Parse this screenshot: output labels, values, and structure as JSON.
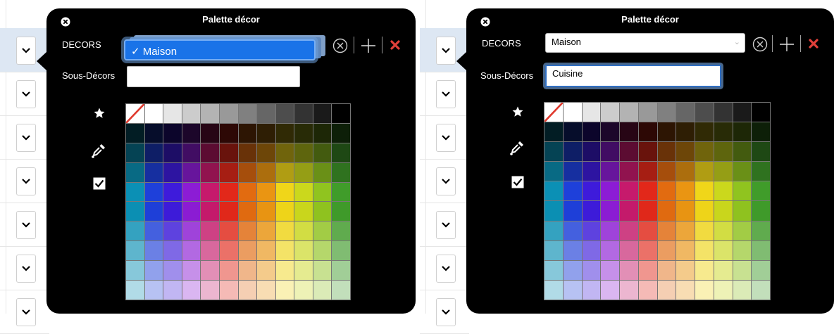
{
  "panels": [
    {
      "title": "Palette décor",
      "decors_label": "DECORS",
      "decors_value": "Maison",
      "decors_state": "open",
      "sous_decors_label": "Sous-Décors",
      "sous_decors_value": ""
    },
    {
      "title": "Palette décor",
      "decors_label": "DECORS",
      "decors_value": "Maison",
      "decors_state": "closed",
      "sous_decors_label": "Sous-Décors",
      "sous_decors_value": "Cuisine"
    }
  ],
  "icons": {
    "close": "circle-x-icon",
    "clear": "circle-x-outline-icon",
    "add": "plus-icon",
    "delete": "red-x-icon",
    "favorites": "star-icon",
    "eyedropper": "eyedropper-icon",
    "checkbox": "checkbox-icon",
    "row_dropdown": "chevron-down-icon"
  },
  "colors": {
    "panel_bg": "#000000",
    "delete_red": "#e0403a",
    "selection_blue": "#1a73e8"
  },
  "palette": {
    "rows": 10,
    "cols": 12,
    "first_row_grays": [
      "none",
      "#ffffff",
      "#e6e6e6",
      "#cccccc",
      "#b3b3b3",
      "#999999",
      "#808080",
      "#666666",
      "#4d4d4d",
      "#333333",
      "#1a1a1a",
      "#000000"
    ],
    "hues": [
      "#0b8fb3",
      "#1e3fd8",
      "#3d1bd9",
      "#8b1cd3",
      "#c41a6b",
      "#e0281a",
      "#e06a10",
      "#e89412",
      "#eed419",
      "#c9d61c",
      "#8fc21f",
      "#3f9a2a"
    ]
  }
}
